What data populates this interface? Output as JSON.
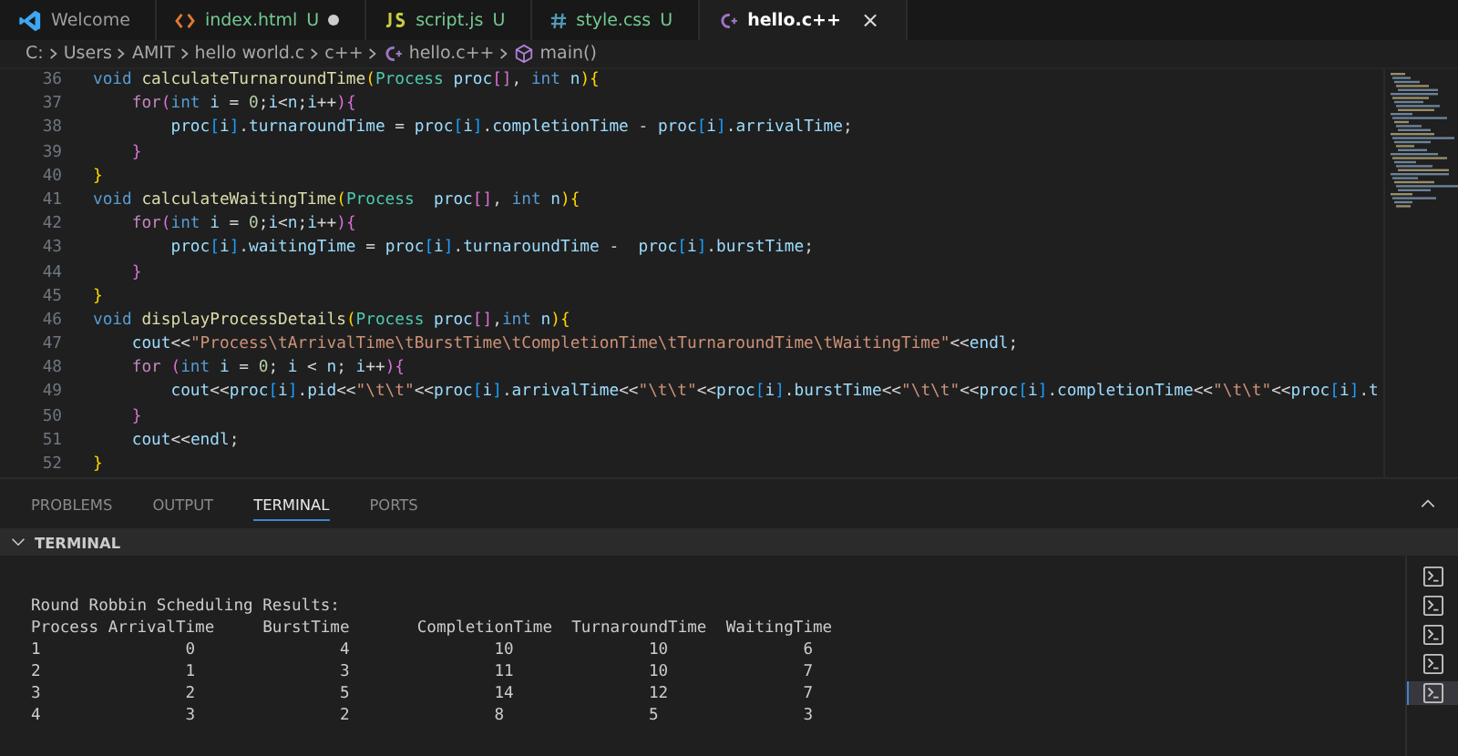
{
  "tabs": [
    {
      "kind": "vscode",
      "label": "Welcome",
      "modified": false,
      "selected": false
    },
    {
      "kind": "html",
      "label": "index.html",
      "status": "U",
      "modified": true,
      "selected": false
    },
    {
      "kind": "js",
      "label": "script.js",
      "status": "U",
      "modified": false,
      "selected": false
    },
    {
      "kind": "css",
      "label": "style.css",
      "status": "U",
      "modified": false,
      "selected": false
    },
    {
      "kind": "cpp",
      "label": "hello.c++",
      "modified": false,
      "selected": true,
      "close": "×"
    }
  ],
  "breadcrumb": [
    {
      "label": "C:"
    },
    {
      "label": "Users"
    },
    {
      "label": "AMIT"
    },
    {
      "label": "hello world.c"
    },
    {
      "label": "c++"
    },
    {
      "label": "hello.c++",
      "kind": "cpp"
    },
    {
      "label": "main()",
      "kind": "symbol"
    }
  ],
  "editor": {
    "lines": [
      {
        "number": "36",
        "tokens": [
          {
            "kind": "kw",
            "text": "void"
          },
          {
            "kind": "fn",
            "text": " calculateTurnaroundTime"
          },
          {
            "kind": "b1",
            "text": "("
          },
          {
            "kind": "type",
            "text": "Process"
          },
          {
            "kind": "var",
            "text": " proc"
          },
          {
            "kind": "b2",
            "text": "[]"
          },
          {
            "kind": "op",
            "text": ", "
          },
          {
            "kind": "kw",
            "text": "int"
          },
          {
            "kind": "var",
            "text": " n"
          },
          {
            "kind": "b1",
            "text": ")"
          },
          {
            "kind": "b1",
            "text": "{"
          }
        ]
      },
      {
        "number": "37",
        "tokens": [
          {
            "kind": "ctrl",
            "text": "    for"
          },
          {
            "kind": "b2",
            "text": "("
          },
          {
            "kind": "kw",
            "text": "int"
          },
          {
            "kind": "var",
            "text": " i"
          },
          {
            "kind": "op",
            "text": " = "
          },
          {
            "kind": "num",
            "text": "0"
          },
          {
            "kind": "op",
            "text": ";"
          },
          {
            "kind": "var",
            "text": "i"
          },
          {
            "kind": "op",
            "text": "<"
          },
          {
            "kind": "var",
            "text": "n"
          },
          {
            "kind": "op",
            "text": ";"
          },
          {
            "kind": "var",
            "text": "i"
          },
          {
            "kind": "op",
            "text": "++"
          },
          {
            "kind": "b2",
            "text": ")"
          },
          {
            "kind": "b2",
            "text": "{"
          }
        ]
      },
      {
        "number": "38",
        "tokens": [
          {
            "kind": "var",
            "text": "        proc"
          },
          {
            "kind": "b3",
            "text": "["
          },
          {
            "kind": "var",
            "text": "i"
          },
          {
            "kind": "b3",
            "text": "]"
          },
          {
            "kind": "op",
            "text": "."
          },
          {
            "kind": "var",
            "text": "turnaroundTime"
          },
          {
            "kind": "op",
            "text": " = "
          },
          {
            "kind": "var",
            "text": "proc"
          },
          {
            "kind": "b3",
            "text": "["
          },
          {
            "kind": "var",
            "text": "i"
          },
          {
            "kind": "b3",
            "text": "]"
          },
          {
            "kind": "op",
            "text": "."
          },
          {
            "kind": "var",
            "text": "completionTime"
          },
          {
            "kind": "op",
            "text": " - "
          },
          {
            "kind": "var",
            "text": "proc"
          },
          {
            "kind": "b3",
            "text": "["
          },
          {
            "kind": "var",
            "text": "i"
          },
          {
            "kind": "b3",
            "text": "]"
          },
          {
            "kind": "op",
            "text": "."
          },
          {
            "kind": "var",
            "text": "arrivalTime"
          },
          {
            "kind": "op",
            "text": ";"
          }
        ]
      },
      {
        "number": "39",
        "tokens": [
          {
            "kind": "b2",
            "text": "    }"
          }
        ]
      },
      {
        "number": "40",
        "tokens": [
          {
            "kind": "b1",
            "text": "}"
          }
        ]
      },
      {
        "number": "41",
        "tokens": [
          {
            "kind": "kw",
            "text": "void"
          },
          {
            "kind": "fn",
            "text": " calculateWaitingTime"
          },
          {
            "kind": "b1",
            "text": "("
          },
          {
            "kind": "type",
            "text": "Process"
          },
          {
            "kind": "var",
            "text": "  proc"
          },
          {
            "kind": "b2",
            "text": "[]"
          },
          {
            "kind": "op",
            "text": ", "
          },
          {
            "kind": "kw",
            "text": "int"
          },
          {
            "kind": "var",
            "text": " n"
          },
          {
            "kind": "b1",
            "text": ")"
          },
          {
            "kind": "b1",
            "text": "{"
          }
        ]
      },
      {
        "number": "42",
        "tokens": [
          {
            "kind": "ctrl",
            "text": "    for"
          },
          {
            "kind": "b2",
            "text": "("
          },
          {
            "kind": "kw",
            "text": "int"
          },
          {
            "kind": "var",
            "text": " i"
          },
          {
            "kind": "op",
            "text": " = "
          },
          {
            "kind": "num",
            "text": "0"
          },
          {
            "kind": "op",
            "text": ";"
          },
          {
            "kind": "var",
            "text": "i"
          },
          {
            "kind": "op",
            "text": "<"
          },
          {
            "kind": "var",
            "text": "n"
          },
          {
            "kind": "op",
            "text": ";"
          },
          {
            "kind": "var",
            "text": "i"
          },
          {
            "kind": "op",
            "text": "++"
          },
          {
            "kind": "b2",
            "text": ")"
          },
          {
            "kind": "b2",
            "text": "{"
          }
        ]
      },
      {
        "number": "43",
        "tokens": [
          {
            "kind": "var",
            "text": "        proc"
          },
          {
            "kind": "b3",
            "text": "["
          },
          {
            "kind": "var",
            "text": "i"
          },
          {
            "kind": "b3",
            "text": "]"
          },
          {
            "kind": "op",
            "text": "."
          },
          {
            "kind": "var",
            "text": "waitingTime"
          },
          {
            "kind": "op",
            "text": " = "
          },
          {
            "kind": "var",
            "text": "proc"
          },
          {
            "kind": "b3",
            "text": "["
          },
          {
            "kind": "var",
            "text": "i"
          },
          {
            "kind": "b3",
            "text": "]"
          },
          {
            "kind": "op",
            "text": "."
          },
          {
            "kind": "var",
            "text": "turnaroundTime"
          },
          {
            "kind": "op",
            "text": " -  "
          },
          {
            "kind": "var",
            "text": "proc"
          },
          {
            "kind": "b3",
            "text": "["
          },
          {
            "kind": "var",
            "text": "i"
          },
          {
            "kind": "b3",
            "text": "]"
          },
          {
            "kind": "op",
            "text": "."
          },
          {
            "kind": "var",
            "text": "burstTime"
          },
          {
            "kind": "op",
            "text": ";"
          }
        ]
      },
      {
        "number": "44",
        "tokens": [
          {
            "kind": "b2",
            "text": "    }"
          }
        ]
      },
      {
        "number": "45",
        "tokens": [
          {
            "kind": "b1",
            "text": "}"
          }
        ]
      },
      {
        "number": "46",
        "tokens": [
          {
            "kind": "kw",
            "text": "void"
          },
          {
            "kind": "fn",
            "text": " displayProcessDetails"
          },
          {
            "kind": "b1",
            "text": "("
          },
          {
            "kind": "type",
            "text": "Process"
          },
          {
            "kind": "var",
            "text": " proc"
          },
          {
            "kind": "b2",
            "text": "[]"
          },
          {
            "kind": "op",
            "text": ","
          },
          {
            "kind": "kw",
            "text": "int"
          },
          {
            "kind": "var",
            "text": " n"
          },
          {
            "kind": "b1",
            "text": ")"
          },
          {
            "kind": "b1",
            "text": "{"
          }
        ]
      },
      {
        "number": "47",
        "tokens": [
          {
            "kind": "var",
            "text": "    cout"
          },
          {
            "kind": "op",
            "text": "<<"
          },
          {
            "kind": "str",
            "text": "\"Process\\tArrivalTime\\tBurstTime\\tCompletionTime\\tTurnaroundTime\\tWaitingTime\""
          },
          {
            "kind": "op",
            "text": "<<"
          },
          {
            "kind": "var",
            "text": "endl"
          },
          {
            "kind": "op",
            "text": ";"
          }
        ]
      },
      {
        "number": "48",
        "tokens": [
          {
            "kind": "ctrl",
            "text": "    for"
          },
          {
            "kind": "b2",
            "text": " ("
          },
          {
            "kind": "kw",
            "text": "int"
          },
          {
            "kind": "var",
            "text": " i"
          },
          {
            "kind": "op",
            "text": " = "
          },
          {
            "kind": "num",
            "text": "0"
          },
          {
            "kind": "op",
            "text": "; "
          },
          {
            "kind": "var",
            "text": "i"
          },
          {
            "kind": "op",
            "text": " < "
          },
          {
            "kind": "var",
            "text": "n"
          },
          {
            "kind": "op",
            "text": "; "
          },
          {
            "kind": "var",
            "text": "i"
          },
          {
            "kind": "op",
            "text": "++"
          },
          {
            "kind": "b2",
            "text": ")"
          },
          {
            "kind": "b2",
            "text": "{"
          }
        ]
      },
      {
        "number": "49",
        "tokens": [
          {
            "kind": "var",
            "text": "        cout"
          },
          {
            "kind": "op",
            "text": "<<"
          },
          {
            "kind": "var",
            "text": "proc"
          },
          {
            "kind": "b3",
            "text": "["
          },
          {
            "kind": "var",
            "text": "i"
          },
          {
            "kind": "b3",
            "text": "]"
          },
          {
            "kind": "op",
            "text": "."
          },
          {
            "kind": "var",
            "text": "pid"
          },
          {
            "kind": "op",
            "text": "<<"
          },
          {
            "kind": "str",
            "text": "\"\\t\\t\""
          },
          {
            "kind": "op",
            "text": "<<"
          },
          {
            "kind": "var",
            "text": "proc"
          },
          {
            "kind": "b3",
            "text": "["
          },
          {
            "kind": "var",
            "text": "i"
          },
          {
            "kind": "b3",
            "text": "]"
          },
          {
            "kind": "op",
            "text": "."
          },
          {
            "kind": "var",
            "text": "arrivalTime"
          },
          {
            "kind": "op",
            "text": "<<"
          },
          {
            "kind": "str",
            "text": "\"\\t\\t\""
          },
          {
            "kind": "op",
            "text": "<<"
          },
          {
            "kind": "var",
            "text": "proc"
          },
          {
            "kind": "b3",
            "text": "["
          },
          {
            "kind": "var",
            "text": "i"
          },
          {
            "kind": "b3",
            "text": "]"
          },
          {
            "kind": "op",
            "text": "."
          },
          {
            "kind": "var",
            "text": "burstTime"
          },
          {
            "kind": "op",
            "text": "<<"
          },
          {
            "kind": "str",
            "text": "\"\\t\\t\""
          },
          {
            "kind": "op",
            "text": "<<"
          },
          {
            "kind": "var",
            "text": "proc"
          },
          {
            "kind": "b3",
            "text": "["
          },
          {
            "kind": "var",
            "text": "i"
          },
          {
            "kind": "b3",
            "text": "]"
          },
          {
            "kind": "op",
            "text": "."
          },
          {
            "kind": "var",
            "text": "completionTime"
          },
          {
            "kind": "op",
            "text": "<<"
          },
          {
            "kind": "str",
            "text": "\"\\t\\t\""
          },
          {
            "kind": "op",
            "text": "<<"
          },
          {
            "kind": "var",
            "text": "proc"
          },
          {
            "kind": "b3",
            "text": "["
          },
          {
            "kind": "var",
            "text": "i"
          },
          {
            "kind": "b3",
            "text": "]"
          },
          {
            "kind": "op",
            "text": "."
          },
          {
            "kind": "var",
            "text": "t"
          }
        ]
      },
      {
        "number": "50",
        "tokens": [
          {
            "kind": "b2",
            "text": "    }"
          }
        ]
      },
      {
        "number": "51",
        "tokens": [
          {
            "kind": "var",
            "text": "    cout"
          },
          {
            "kind": "op",
            "text": "<<"
          },
          {
            "kind": "var",
            "text": "endl"
          },
          {
            "kind": "op",
            "text": ";"
          }
        ]
      },
      {
        "number": "52",
        "tokens": [
          {
            "kind": "b1",
            "text": "}"
          }
        ]
      }
    ]
  },
  "panel": {
    "tabs": [
      {
        "label": "PROBLEMS",
        "selected": false
      },
      {
        "label": "OUTPUT",
        "selected": false
      },
      {
        "label": "TERMINAL",
        "selected": true
      },
      {
        "label": "PORTS",
        "selected": false
      }
    ],
    "section_title": "TERMINAL",
    "output": [
      "Round Robbin Scheduling Results:",
      "Process ArrivalTime     BurstTime       CompletionTime  TurnaroundTime  WaitingTime",
      "1               0               4               10              10              6",
      "2               1               3               11              10              7",
      "3               2               5               14              12              7",
      "4               3               2               8               5               3"
    ],
    "terminals": [
      {
        "selected": false
      },
      {
        "selected": false
      },
      {
        "selected": false
      },
      {
        "selected": false
      },
      {
        "selected": true
      }
    ]
  }
}
